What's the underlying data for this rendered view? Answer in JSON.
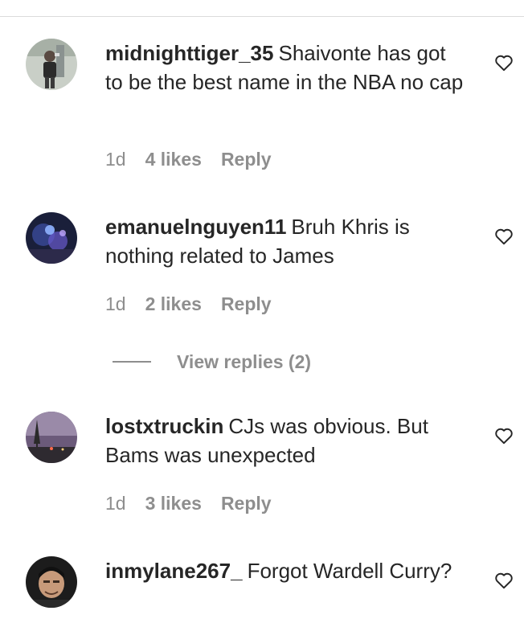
{
  "comments": [
    {
      "username": "midnighttiger_35",
      "text": "Shaivonte has got to be the best name in the NBA no cap",
      "time": "1d",
      "likes": "4 likes",
      "reply": "Reply",
      "like_icon": "heart-outline-icon"
    },
    {
      "username": "emanuelnguyen11",
      "text": "Bruh Khris is nothing related to James",
      "time": "1d",
      "likes": "2 likes",
      "reply": "Reply",
      "like_icon": "heart-outline-icon"
    },
    {
      "username": "lostxtruckin",
      "text": "CJs was obvious. But Bams was unexpected",
      "time": "1d",
      "likes": "3 likes",
      "reply": "Reply",
      "like_icon": "heart-outline-icon"
    },
    {
      "username": "inmylane267_",
      "text": "Forgot Wardell Curry?",
      "like_icon": "heart-outline-icon"
    }
  ],
  "view_replies": {
    "label": "View replies (2)"
  },
  "colors": {
    "text": "#262626",
    "secondary": "#8e8e8e",
    "divider": "#dbdbdb"
  }
}
